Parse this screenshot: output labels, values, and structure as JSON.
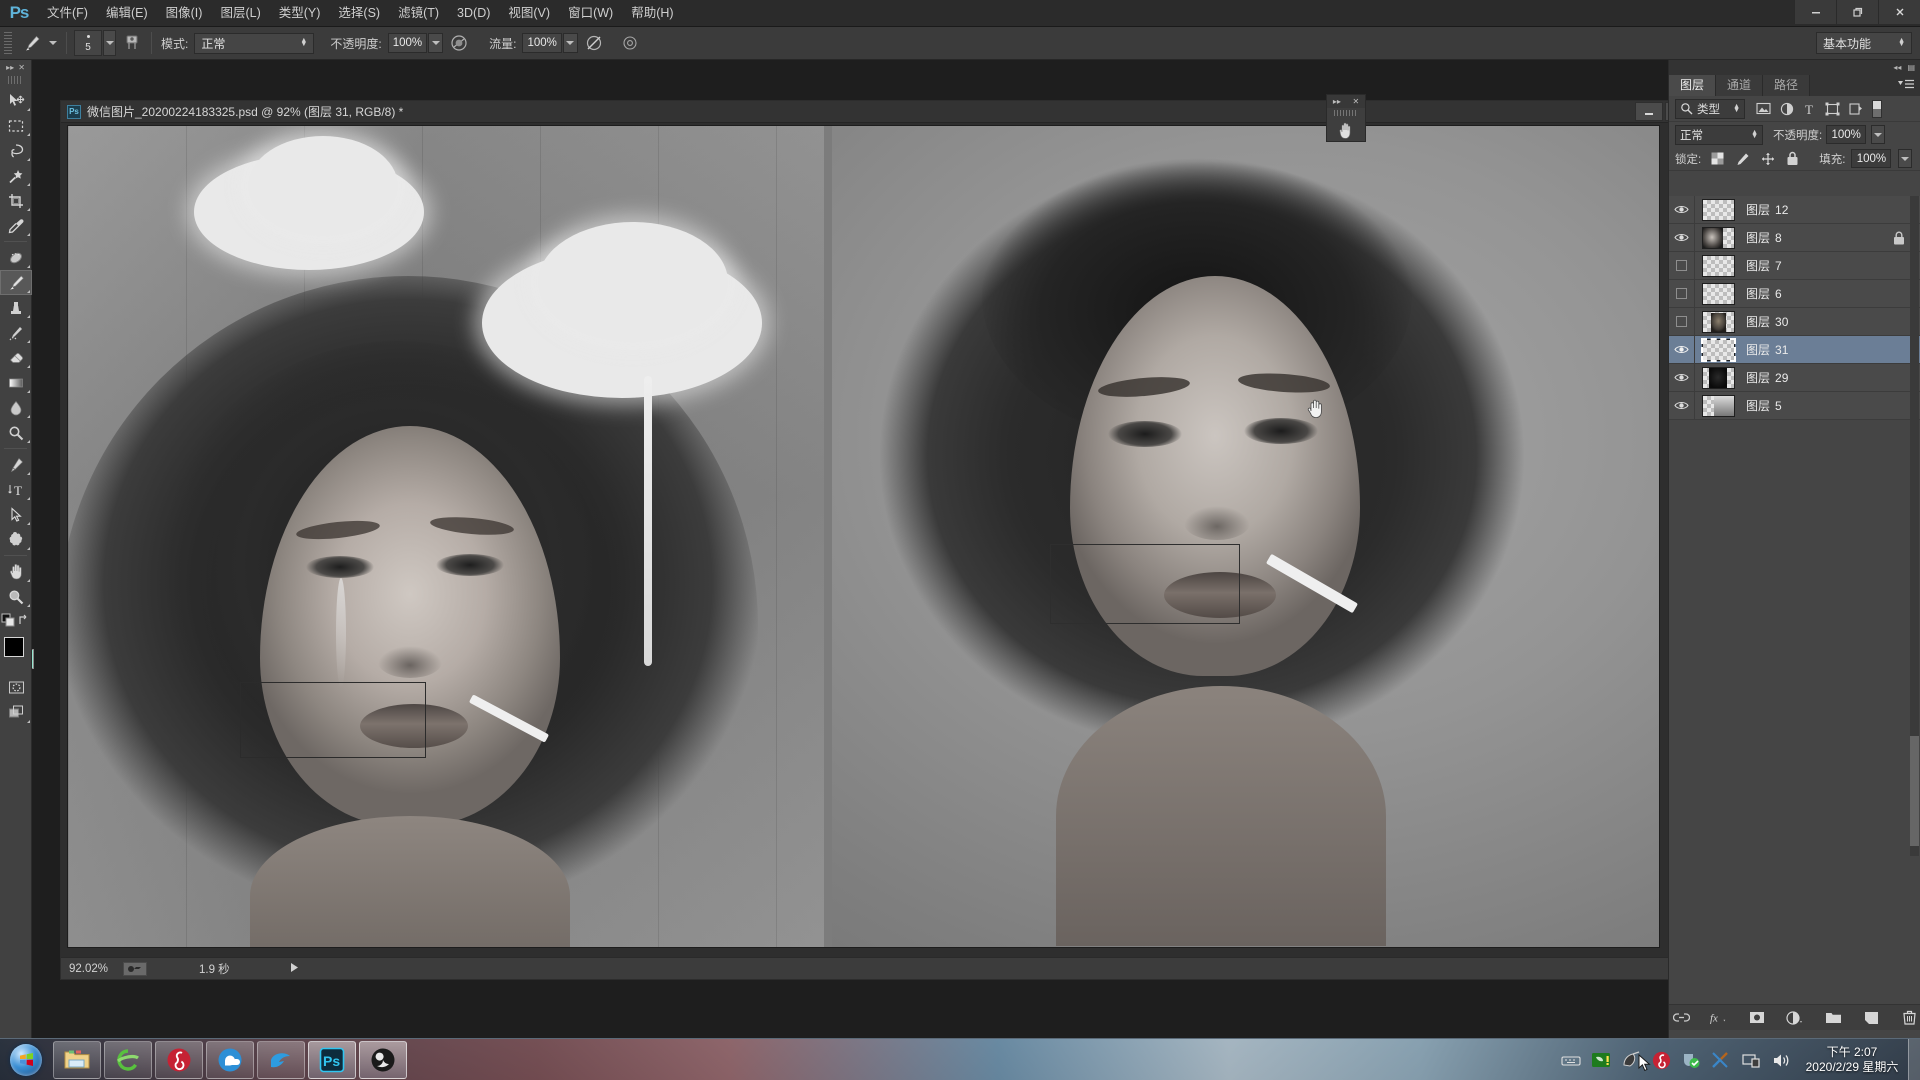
{
  "app": {
    "name": "Adobe Photoshop",
    "logo_text": "Ps",
    "workspace": "基本功能"
  },
  "menubar": {
    "items": [
      {
        "label": "文件(F)"
      },
      {
        "label": "编辑(E)"
      },
      {
        "label": "图像(I)"
      },
      {
        "label": "图层(L)"
      },
      {
        "label": "类型(Y)"
      },
      {
        "label": "选择(S)"
      },
      {
        "label": "滤镜(T)"
      },
      {
        "label": "3D(D)"
      },
      {
        "label": "视图(V)"
      },
      {
        "label": "窗口(W)"
      },
      {
        "label": "帮助(H)"
      }
    ],
    "window_controls": {
      "minimize": "—",
      "restore": "❐",
      "close": "✕"
    }
  },
  "options_bar": {
    "brush_size": "5",
    "mode_label": "模式:",
    "mode_value": "正常",
    "opacity_label": "不透明度:",
    "opacity_value": "100%",
    "flow_label": "流量:",
    "flow_value": "100%"
  },
  "toolbar": {
    "tools": [
      {
        "name": "move-tool",
        "glyph": "move"
      },
      {
        "name": "marquee-tool",
        "glyph": "marquee"
      },
      {
        "name": "lasso-tool",
        "glyph": "lasso"
      },
      {
        "name": "magic-wand-tool",
        "glyph": "wand"
      },
      {
        "name": "crop-tool",
        "glyph": "crop"
      },
      {
        "name": "eyedropper-tool",
        "glyph": "eyedropper"
      },
      {
        "name": "healing-brush-tool",
        "glyph": "healing"
      },
      {
        "name": "brush-tool",
        "glyph": "brush",
        "active": true
      },
      {
        "name": "clone-stamp-tool",
        "glyph": "stamp"
      },
      {
        "name": "history-brush-tool",
        "glyph": "historybrush"
      },
      {
        "name": "eraser-tool",
        "glyph": "eraser"
      },
      {
        "name": "gradient-tool",
        "glyph": "gradient"
      },
      {
        "name": "blur-tool",
        "glyph": "blur"
      },
      {
        "name": "dodge-tool",
        "glyph": "dodge"
      },
      {
        "name": "pen-tool",
        "glyph": "pen"
      },
      {
        "name": "type-tool",
        "glyph": "type"
      },
      {
        "name": "path-selection-tool",
        "glyph": "pathselect"
      },
      {
        "name": "shape-tool",
        "glyph": "shape"
      },
      {
        "name": "hand-tool",
        "glyph": "hand"
      },
      {
        "name": "zoom-tool",
        "glyph": "zoom"
      }
    ],
    "foreground_color": "#000000",
    "background_color": "#96e6cf"
  },
  "document": {
    "title": "微信图片_20200224183325.psd @ 92% (图层 31, RGB/8) *",
    "badge": "Ps",
    "window_controls": {
      "minimize": "—",
      "maximize": "❐"
    }
  },
  "statusbar": {
    "zoom": "92.02%",
    "timing": "1.9 秒"
  },
  "layers_panel": {
    "header_tabs": [
      {
        "label": "图层",
        "active": true
      },
      {
        "label": "通道",
        "active": false
      },
      {
        "label": "路径",
        "active": false
      }
    ],
    "filter": {
      "kind_label": "类型",
      "icons": [
        "image-filter-icon",
        "adjustment-filter-icon",
        "type-filter-icon",
        "shape-filter-icon",
        "smartobject-filter-icon"
      ]
    },
    "blend_mode": "正常",
    "opacity_label": "不透明度:",
    "opacity_value": "100%",
    "lock_label": "锁定:",
    "lock_icons": [
      "lock-transparency-icon",
      "lock-image-icon",
      "lock-position-icon",
      "lock-all-icon"
    ],
    "fill_label": "填充:",
    "fill_value": "100%",
    "layers": [
      {
        "name": "图层",
        "number": "12",
        "visible": true,
        "selected": false,
        "locked": false,
        "thumb": "empty"
      },
      {
        "name": "图层",
        "number": "8",
        "visible": true,
        "selected": false,
        "locked": true,
        "thumb": "portrait"
      },
      {
        "name": "图层",
        "number": "7",
        "visible": false,
        "selected": false,
        "locked": false,
        "thumb": "empty"
      },
      {
        "name": "图层",
        "number": "6",
        "visible": false,
        "selected": false,
        "locked": false,
        "thumb": "empty"
      },
      {
        "name": "图层",
        "number": "30",
        "visible": false,
        "selected": false,
        "locked": false,
        "thumb": "smallportrait"
      },
      {
        "name": "图层",
        "number": "31",
        "visible": true,
        "selected": true,
        "locked": false,
        "thumb": "empty"
      },
      {
        "name": "图层",
        "number": "29",
        "visible": true,
        "selected": false,
        "locked": false,
        "thumb": "silhouette"
      },
      {
        "name": "图层",
        "number": "5",
        "visible": true,
        "selected": false,
        "locked": false,
        "thumb": "gradient"
      }
    ],
    "footer_buttons": [
      {
        "name": "link-layers-button",
        "glyph": "link"
      },
      {
        "name": "layer-style-button",
        "glyph": "fx"
      },
      {
        "name": "add-mask-button",
        "glyph": "mask"
      },
      {
        "name": "adjustment-layer-button",
        "glyph": "adjustment"
      },
      {
        "name": "new-group-button",
        "glyph": "folder"
      },
      {
        "name": "new-layer-button",
        "glyph": "newlayer"
      },
      {
        "name": "delete-layer-button",
        "glyph": "trash"
      }
    ]
  },
  "artwork": {
    "left_caption": "grayscale portrait with clouds and cigarette",
    "right_caption": "grayscale portrait zoomed with cigarette"
  },
  "taskbar": {
    "apps": [
      {
        "name": "start-orb",
        "label": "Start"
      },
      {
        "name": "file-explorer",
        "label": "Windows Explorer"
      },
      {
        "name": "internet-explorer",
        "label": "Internet Explorer"
      },
      {
        "name": "netease-music",
        "label": "网易云音乐"
      },
      {
        "name": "qq-browser",
        "label": "QQ浏览器"
      },
      {
        "name": "thunder-download",
        "label": "迅雷"
      },
      {
        "name": "photoshop",
        "label": "Photoshop"
      },
      {
        "name": "obs-studio",
        "label": "OBS Studio"
      }
    ],
    "tray_icons": [
      "keyboard-icon",
      "nvidia-icon",
      "mouse-icon",
      "netease-icon",
      "security-icon",
      "network-tool-icon",
      "network-icon",
      "volume-icon"
    ],
    "clock": {
      "time": "下午 2:07",
      "date": "2020/2/29 星期六"
    }
  }
}
